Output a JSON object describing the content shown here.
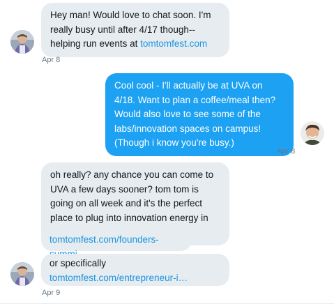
{
  "messages": [
    {
      "text_1": "Hey man! Would love to chat soon. I'm really busy until after 4/17 though-- helping run events at ",
      "link": "tomtomfest.com",
      "timestamp": "Apr 8"
    },
    {
      "text": "Cool cool - I'll actually be at UVA on 4/18. Want to plan a coffee/meal then? Would also love to see some of the labs/innovation spaces on campus! (Though i know you're busy.)",
      "timestamp": "Apr 8"
    },
    {
      "text": "oh really? any chance you can come to UVA a few days sooner? tom tom is going on all week and it's the perfect place to plug into innovation energy in town"
    },
    {
      "link": "tomtomfest.com/founders-summi…"
    },
    {
      "text_1": "or specifically ",
      "link": "tomtomfest.com/entrepreneur-i…",
      "timestamp": "Apr 9"
    }
  ],
  "colors": {
    "incoming_bubble": "#e6ecf0",
    "outgoing_bubble": "#1da1f2",
    "link": "#1b95e0",
    "timestamp": "#657786"
  },
  "icons": {
    "contact_avatar": "avatar",
    "self_avatar": "avatar"
  }
}
